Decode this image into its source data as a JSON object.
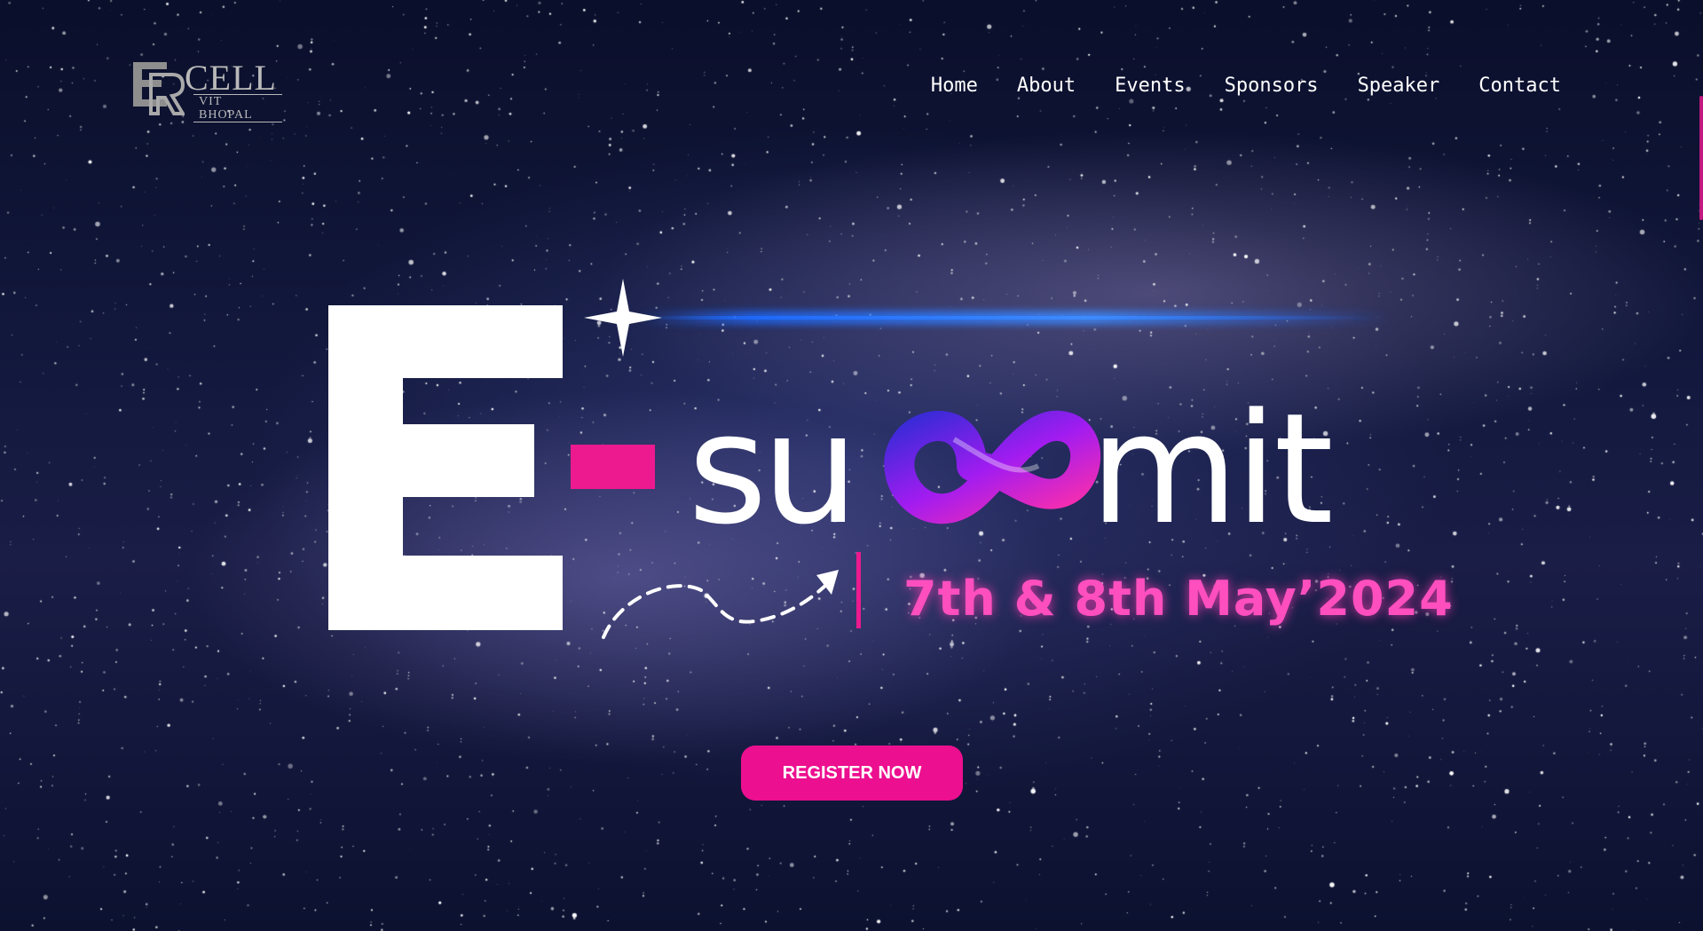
{
  "brand": {
    "logo_mark": "E",
    "logo_word": "CELL",
    "logo_sub": "VIT BHOPAL"
  },
  "nav": {
    "items": [
      {
        "label": "Home"
      },
      {
        "label": "About"
      },
      {
        "label": "Events"
      },
      {
        "label": "Sponsors"
      },
      {
        "label": "Speaker"
      },
      {
        "label": "Contact"
      }
    ]
  },
  "hero": {
    "title_letter": "E",
    "title_rest": "su",
    "title_end": "mit",
    "infinity_icon": "infinity-icon",
    "date": "7th & 8th May’2024",
    "register_label": "REGISTER NOW"
  },
  "colors": {
    "accent": "#ec0f8f",
    "pink_glow": "#ff4fbf",
    "blue_beam": "#1e6bff",
    "background": "#0b0f24"
  }
}
